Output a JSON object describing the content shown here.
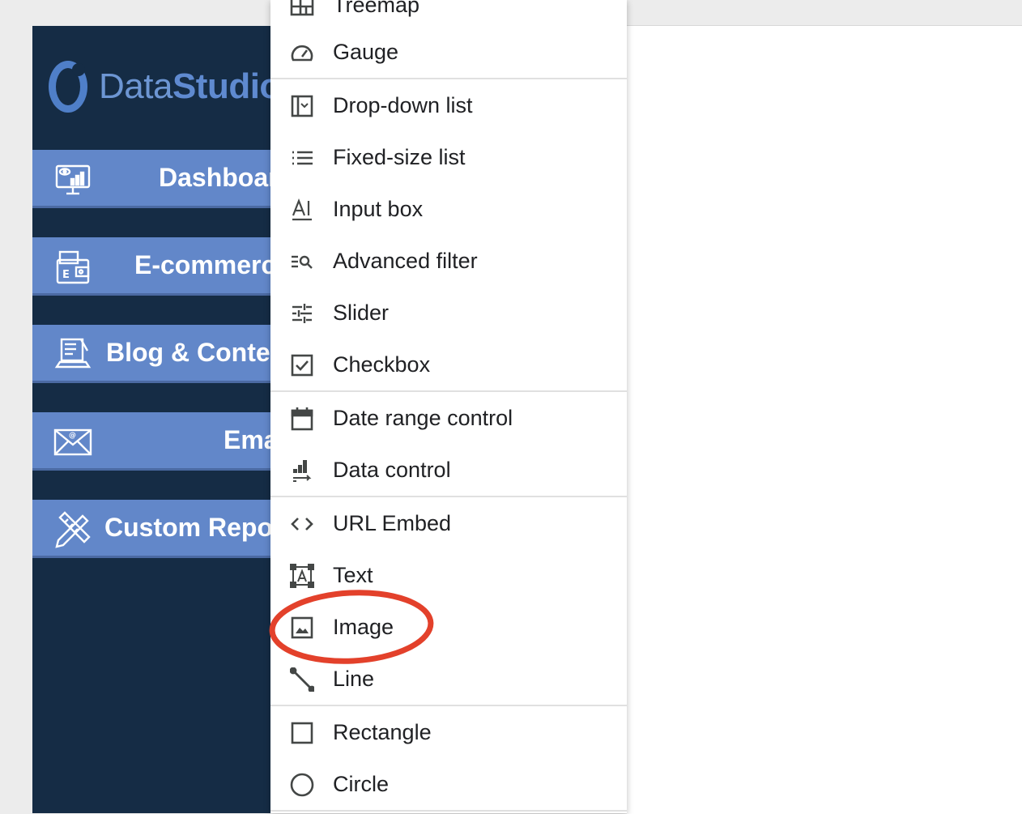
{
  "sidebar": {
    "logo_prefix": "Data",
    "logo_suffix": "Studio",
    "buttons": [
      {
        "label": "Dashboard",
        "icon": "monitor-analytics-icon"
      },
      {
        "label": "E-commerce",
        "icon": "wallet-icon"
      },
      {
        "label": "Blog & Content",
        "icon": "laptop-document-icon"
      },
      {
        "label": "Email",
        "icon": "envelope-icon"
      },
      {
        "label": "Custom Reports",
        "icon": "pencil-ruler-icon"
      }
    ]
  },
  "menu": {
    "items": [
      {
        "label": "Treemap",
        "icon": "treemap-icon"
      },
      {
        "label": "Gauge",
        "icon": "gauge-icon"
      },
      {
        "label": "Drop-down list",
        "icon": "dropdown-list-icon"
      },
      {
        "label": "Fixed-size list",
        "icon": "fixed-list-icon"
      },
      {
        "label": "Input box",
        "icon": "input-box-icon"
      },
      {
        "label": "Advanced filter",
        "icon": "advanced-filter-icon"
      },
      {
        "label": "Slider",
        "icon": "slider-icon"
      },
      {
        "label": "Checkbox",
        "icon": "checkbox-icon"
      },
      {
        "label": "Date range control",
        "icon": "calendar-icon"
      },
      {
        "label": "Data control",
        "icon": "data-control-icon"
      },
      {
        "label": "URL Embed",
        "icon": "code-icon"
      },
      {
        "label": "Text",
        "icon": "text-box-icon"
      },
      {
        "label": "Image",
        "icon": "image-icon"
      },
      {
        "label": "Line",
        "icon": "line-icon"
      },
      {
        "label": "Rectangle",
        "icon": "rectangle-icon"
      },
      {
        "label": "Circle",
        "icon": "circle-icon"
      }
    ]
  },
  "colors": {
    "sidebar_bg": "#152c45",
    "nav_button": "#6287c9",
    "highlight": "#e3412b",
    "icon": "#444746"
  }
}
